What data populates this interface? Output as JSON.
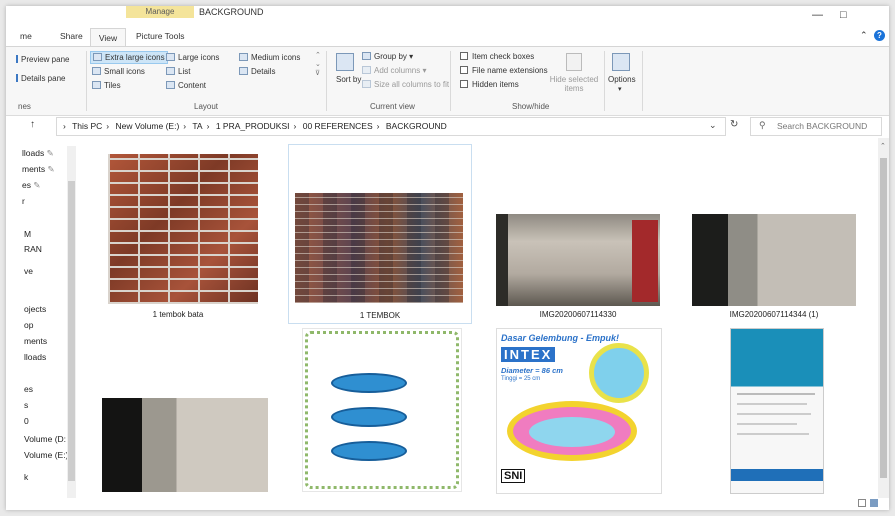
{
  "window": {
    "context_tab": "Manage",
    "title": "BACKGROUND",
    "minimize": "—",
    "maximize": "□",
    "help": "?"
  },
  "ribbon_tabs": [
    "me",
    "Share",
    "View",
    "Picture Tools"
  ],
  "ribbon": {
    "panes": {
      "preview_pane": "Preview pane",
      "details_pane": "Details pane",
      "group_label": "nes"
    },
    "layout": {
      "extra_large_icons": "Extra large icons",
      "large_icons": "Large icons",
      "medium_icons": "Medium icons",
      "small_icons": "Small icons",
      "list": "List",
      "details": "Details",
      "tiles": "Tiles",
      "content": "Content",
      "group_label": "Layout"
    },
    "current_view": {
      "sort_by": "Sort by",
      "group_by": "Group by",
      "add_columns": "Add columns",
      "size_all_columns": "Size all columns to fit",
      "group_label": "Current view"
    },
    "show_hide": {
      "item_check_boxes": "Item check boxes",
      "file_name_extensions": "File name extensions",
      "hidden_items": "Hidden items",
      "hide_selected_items": "Hide selected items",
      "group_label": "Show/hide"
    },
    "options": "Options"
  },
  "address": {
    "crumbs": [
      "This PC",
      "New Volume (E:)",
      "TA",
      "1 PRA_PRODUKSI",
      "00 REFERENCES",
      "BACKGROUND"
    ],
    "search_placeholder": "Search BACKGROUND"
  },
  "nav_items": [
    "lloads",
    "ments",
    "es",
    "r",
    "M",
    "RAN",
    "ve",
    "",
    "ojects",
    "op",
    "ments",
    "lloads",
    "",
    "es",
    "s",
    "0",
    "Volume (D:",
    "Volume (E:)",
    "k"
  ],
  "files": [
    {
      "name": "1 tembok bata"
    },
    {
      "name": "1 TEMBOK"
    },
    {
      "name": "IMG20200607114330"
    },
    {
      "name": "IMG20200607114344 (1)"
    },
    {
      "name": ""
    },
    {
      "name": ""
    },
    {
      "name": ""
    },
    {
      "name": ""
    }
  ],
  "thumb_text": {
    "pool_heading": "Dasar Gelembung - Empuk!",
    "pool_brand": "INTEX",
    "pool_diameter": "Diameter = 86 cm",
    "pool_height": "Tinggi = 25 cm",
    "pool_sni": "SNI"
  }
}
